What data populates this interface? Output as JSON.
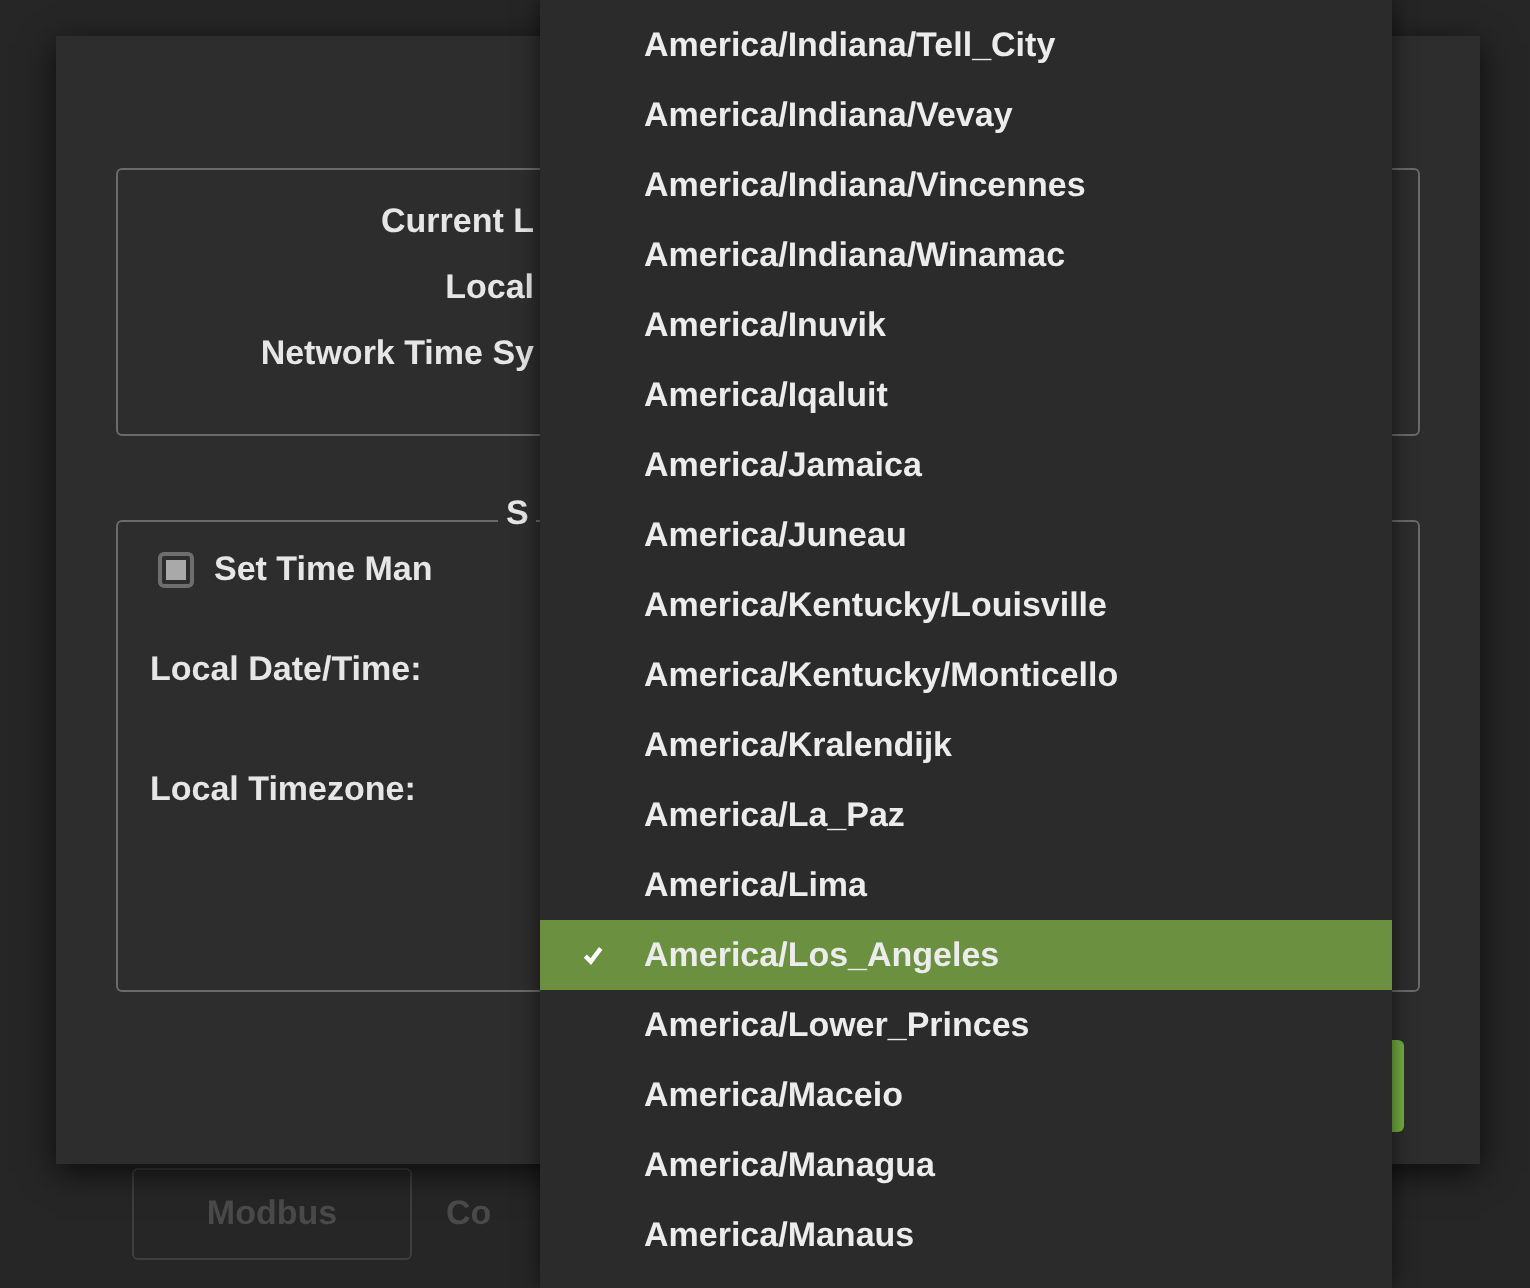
{
  "background_tabs": [
    {
      "label": "Modbus"
    },
    {
      "label": "Co"
    }
  ],
  "dialog": {
    "status_labels": [
      "Current L",
      "Local",
      "Network Time Sy"
    ],
    "manual_section": {
      "legend": "S",
      "set_manually": {
        "label": "Set Time Man",
        "checked": false
      },
      "date_time_label": "Local Date/Time:",
      "timezone_label": "Local Timezone:"
    }
  },
  "timezone_dropdown": {
    "options": [
      {
        "label": "America/Indiana/Tell_City",
        "selected": false
      },
      {
        "label": "America/Indiana/Vevay",
        "selected": false
      },
      {
        "label": "America/Indiana/Vincennes",
        "selected": false
      },
      {
        "label": "America/Indiana/Winamac",
        "selected": false
      },
      {
        "label": "America/Inuvik",
        "selected": false
      },
      {
        "label": "America/Iqaluit",
        "selected": false
      },
      {
        "label": "America/Jamaica",
        "selected": false
      },
      {
        "label": "America/Juneau",
        "selected": false
      },
      {
        "label": "America/Kentucky/Louisville",
        "selected": false
      },
      {
        "label": "America/Kentucky/Monticello",
        "selected": false
      },
      {
        "label": "America/Kralendijk",
        "selected": false
      },
      {
        "label": "America/La_Paz",
        "selected": false
      },
      {
        "label": "America/Lima",
        "selected": false
      },
      {
        "label": "America/Los_Angeles",
        "selected": true
      },
      {
        "label": "America/Lower_Princes",
        "selected": false
      },
      {
        "label": "America/Maceio",
        "selected": false
      },
      {
        "label": "America/Managua",
        "selected": false
      },
      {
        "label": "America/Manaus",
        "selected": false
      }
    ]
  }
}
